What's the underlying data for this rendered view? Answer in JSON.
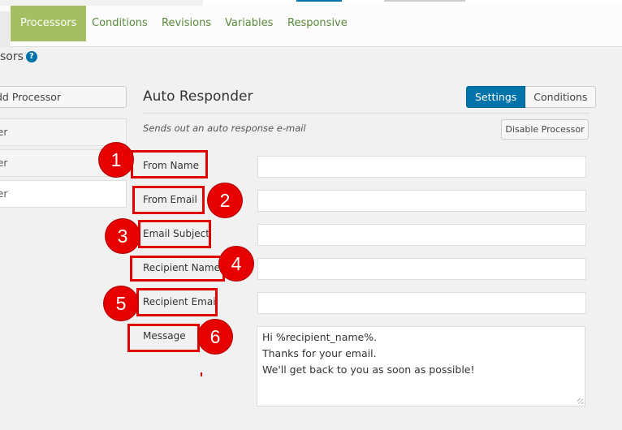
{
  "tabs": [
    {
      "label": "Processors",
      "active": true
    },
    {
      "label": "Conditions",
      "active": false
    },
    {
      "label": "Revisions",
      "active": false
    },
    {
      "label": "Variables",
      "active": false
    },
    {
      "label": "Responsive",
      "active": false
    }
  ],
  "section": {
    "title": "sors",
    "help_icon": "question-circle-icon"
  },
  "sidebar": {
    "add_label": "dd Processor",
    "items": [
      {
        "label": "er"
      },
      {
        "label": "er"
      },
      {
        "label": "er"
      }
    ]
  },
  "panel": {
    "title": "Auto Responder",
    "settings_label": "Settings",
    "conditions_label": "Conditions",
    "description": "Sends out an auto response e-mail",
    "disable_label": "Disable Processor"
  },
  "fields": [
    {
      "label": "From Name",
      "value": "",
      "badge": "1"
    },
    {
      "label": "From Email",
      "value": "",
      "badge": "2"
    },
    {
      "label": "Email Subject",
      "value": "",
      "badge": "3"
    },
    {
      "label": "Recipient Name",
      "value": "",
      "badge": "4"
    },
    {
      "label": "Recipient Email",
      "value": "",
      "badge": "5"
    },
    {
      "label": "Message",
      "badge": "6",
      "lines": [
        "Hi %recipient_name%.",
        "Thanks for your email.",
        "We'll get back to you as soon as possible!"
      ]
    }
  ],
  "colors": {
    "tab_active": "#a3bf61",
    "tab_text": "#5a8a3c",
    "primary": "#0073aa",
    "annotation": "#e00000"
  }
}
